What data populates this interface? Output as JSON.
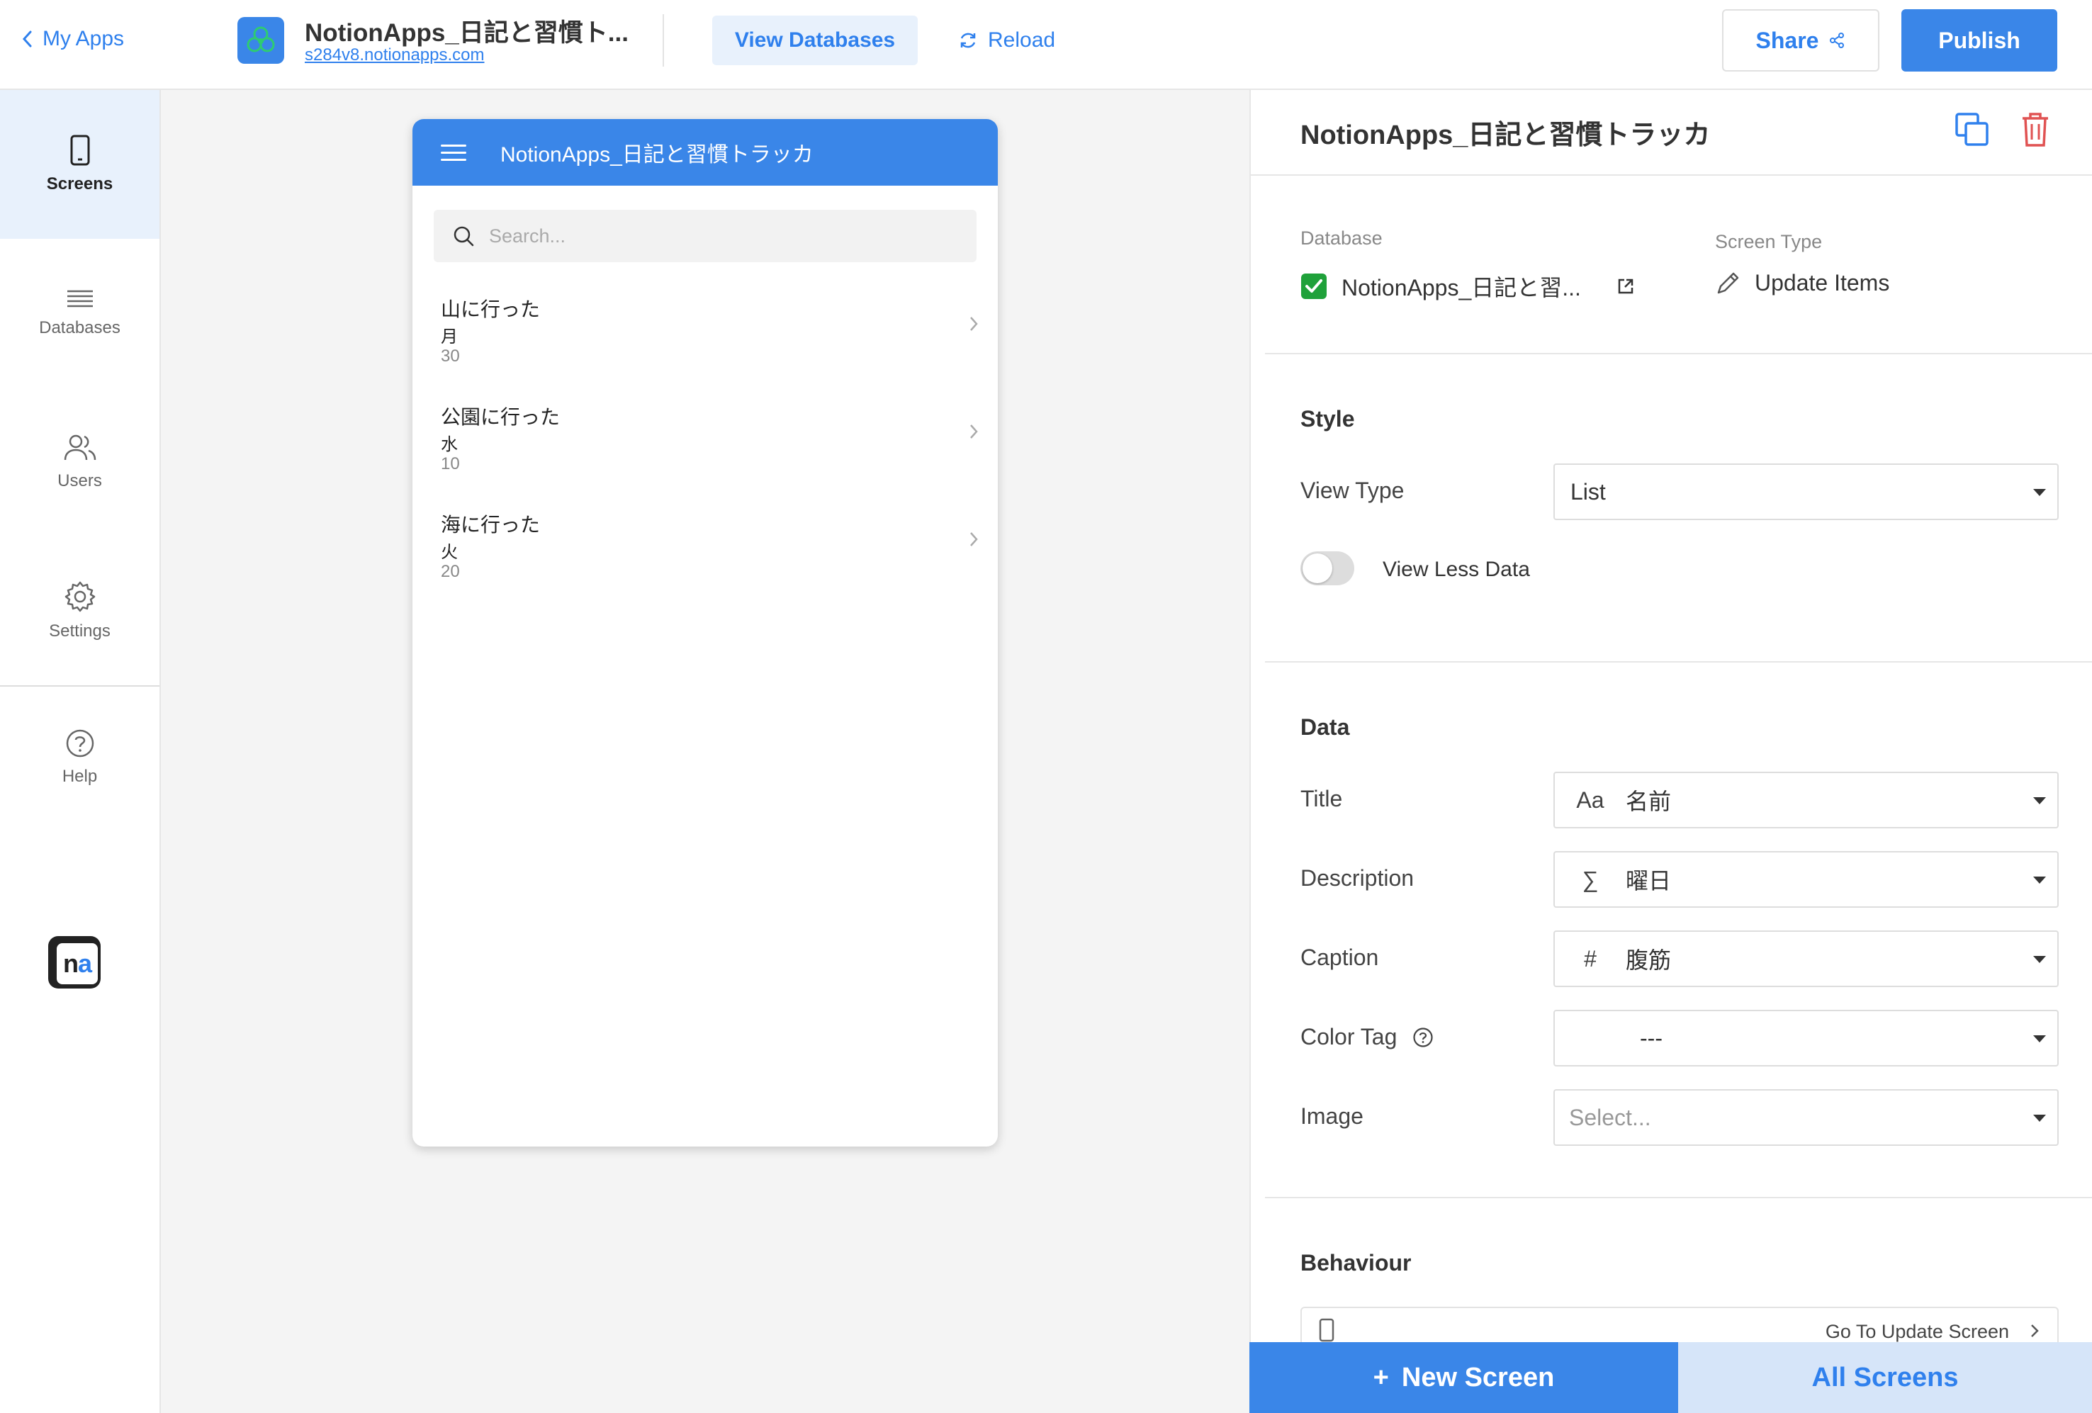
{
  "topbar": {
    "back_label": "My Apps",
    "app_title": "NotionApps_日記と習慣ト...",
    "app_url": "s284v8.notionapps.com",
    "view_databases": "View Databases",
    "reload": "Reload",
    "share": "Share",
    "publish": "Publish"
  },
  "sidebar": {
    "items": [
      {
        "label": "Screens",
        "icon": "phone-icon",
        "active": true
      },
      {
        "label": "Databases",
        "icon": "list-icon",
        "active": false
      },
      {
        "label": "Users",
        "icon": "users-icon",
        "active": false
      },
      {
        "label": "Settings",
        "icon": "gear-icon",
        "active": false
      },
      {
        "label": "Help",
        "icon": "help-icon",
        "active": false
      }
    ]
  },
  "preview": {
    "header_title": "NotionApps_日記と習慣トラッカ",
    "search_placeholder": "Search...",
    "items": [
      {
        "title": "山に行った",
        "description": "月",
        "caption": "30"
      },
      {
        "title": "公園に行った",
        "description": "水",
        "caption": "10"
      },
      {
        "title": "海に行った",
        "description": "火",
        "caption": "20"
      }
    ]
  },
  "panel": {
    "title": "NotionApps_日記と習慣トラッカ",
    "database_label": "Database",
    "database_value": "NotionApps_日記と習...",
    "screen_type_label": "Screen Type",
    "screen_type_value": "Update Items",
    "style_heading": "Style",
    "view_type_label": "View Type",
    "view_type_value": "List",
    "view_less_data_label": "View Less Data",
    "view_less_data_on": false,
    "data_heading": "Data",
    "fields": [
      {
        "label": "Title",
        "icon_text": "Aa",
        "value": "名前"
      },
      {
        "label": "Description",
        "icon_text": "∑",
        "value": "曜日"
      },
      {
        "label": "Caption",
        "icon_text": "#",
        "value": "腹筋"
      },
      {
        "label": "Color Tag",
        "icon_text": "",
        "value": "---"
      },
      {
        "label": "Image",
        "icon_text": "",
        "value": "Select..."
      }
    ],
    "behaviour_heading": "Behaviour",
    "behaviour_action": "Go To Update Screen"
  },
  "bottom": {
    "new_screen": "New Screen",
    "new_screen_plus": "+",
    "all_screens": "All Screens"
  },
  "colors": {
    "accent": "#3a86e8",
    "danger": "#e05252",
    "check_green": "#1fa13a"
  }
}
